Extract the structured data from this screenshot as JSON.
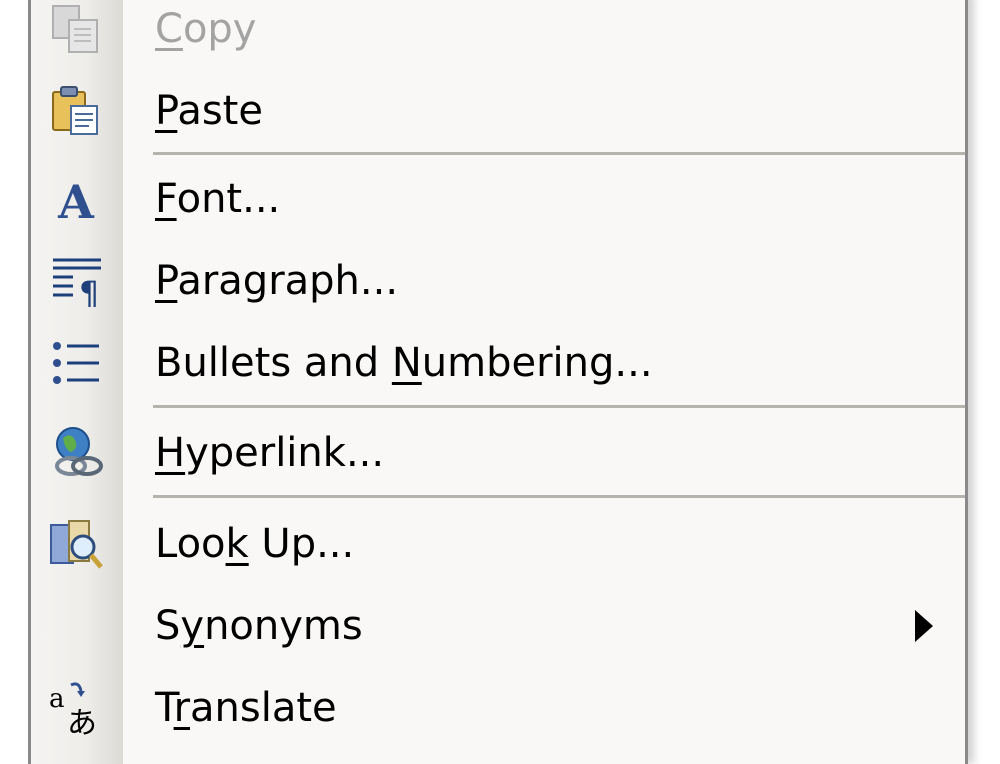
{
  "menu": {
    "items": [
      {
        "pre": "",
        "ul": "C",
        "post": "opy",
        "icon": "copy-icon",
        "disabled": true
      },
      {
        "pre": "",
        "ul": "P",
        "post": "aste",
        "icon": "paste-icon"
      },
      {
        "pre": "",
        "ul": "F",
        "post": "ont...",
        "icon": "font-icon"
      },
      {
        "pre": "",
        "ul": "P",
        "post": "aragraph...",
        "icon": "paragraph-icon"
      },
      {
        "pre": "Bullets and ",
        "ul": "N",
        "post": "umbering...",
        "icon": "bullets-icon"
      },
      {
        "pre": "",
        "ul": "H",
        "post": "yperlink...",
        "icon": "hyperlink-icon"
      },
      {
        "pre": "Loo",
        "ul": "k",
        "post": " Up...",
        "icon": "lookup-icon"
      },
      {
        "pre": "S",
        "ul": "y",
        "post": "nonyms",
        "icon": "",
        "submenu": true
      },
      {
        "pre": "T",
        "ul": "r",
        "post": "anslate",
        "icon": "translate-icon"
      }
    ]
  }
}
